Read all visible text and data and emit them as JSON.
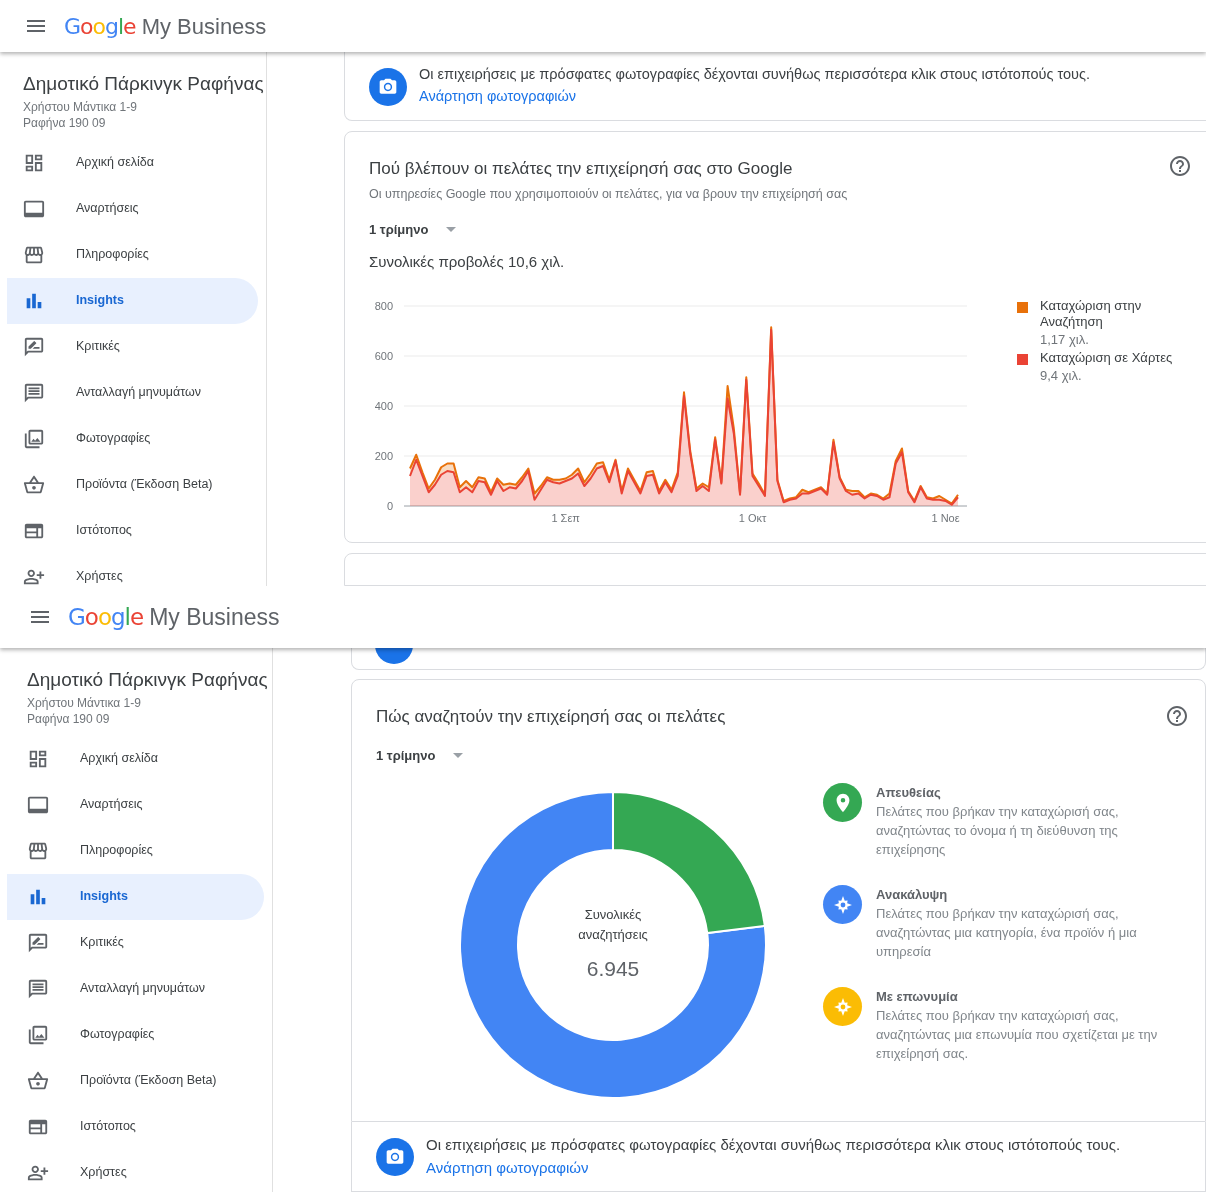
{
  "panels": [
    {
      "header": {
        "logo": "Google",
        "product": "My Business"
      },
      "sidebar": {
        "business_name": "Δημοτικό Πάρκινγκ Ραφήνας",
        "address_lines": [
          "Χρήστου Μάντικα 1-9",
          "Ραφήνα 190 09"
        ],
        "items": [
          {
            "label": "Αρχική σελίδα",
            "selected": false
          },
          {
            "label": "Αναρτήσεις",
            "selected": false
          },
          {
            "label": "Πληροφορίες",
            "selected": false
          },
          {
            "label": "Insights",
            "selected": true
          },
          {
            "label": "Κριτικές",
            "selected": false
          },
          {
            "label": "Ανταλλαγή μηνυμάτων",
            "selected": false
          },
          {
            "label": "Φωτογραφίες",
            "selected": false
          },
          {
            "label": "Προϊόντα (Έκδοση Beta)",
            "selected": false
          },
          {
            "label": "Ιστότοπος",
            "selected": false
          },
          {
            "label": "Χρήστες",
            "selected": false
          }
        ]
      },
      "cards": [
        {
          "kind": "photo_tip",
          "text": "Οι επιχειρήσεις με πρόσφατες φωτογραφίες δέχονται συνήθως περισσότερα κλικ στους ιστότοπούς τους.",
          "link": "Ανάρτηση φωτογραφιών"
        },
        {
          "kind": "views",
          "title": "Πού βλέπουν οι πελάτες την επιχείρησή σας στο Google",
          "subtitle": "Οι υπηρεσίες Google που χρησιμοποιούν οι πελάτες, για να βρουν την επιχείρησή σας",
          "period": "1 τρίμηνο",
          "total": "Συνολικές προβολές 10,6 χιλ.",
          "legend_totals": [
            "1,17 χιλ.",
            "9,4 χιλ."
          ],
          "chart_data": {
            "type": "area",
            "stacked": true,
            "categories": [
              null,
              null,
              null,
              null,
              null,
              null,
              null,
              null,
              null,
              null,
              null,
              null,
              null,
              null,
              null,
              null,
              null,
              null,
              null,
              null,
              null,
              null,
              null,
              null,
              null,
              "1 Σεπ",
              null,
              null,
              null,
              null,
              null,
              null,
              null,
              null,
              null,
              null,
              null,
              null,
              null,
              null,
              null,
              null,
              null,
              null,
              null,
              null,
              null,
              null,
              null,
              null,
              null,
              null,
              null,
              null,
              null,
              "1 Οκτ",
              null,
              null,
              null,
              null,
              null,
              null,
              null,
              null,
              null,
              null,
              null,
              null,
              null,
              null,
              null,
              null,
              null,
              null,
              null,
              null,
              null,
              null,
              null,
              null,
              null,
              null,
              null,
              null,
              null,
              null,
              "1 Νοε",
              null,
              null
            ],
            "ylim": [
              0,
              800
            ],
            "yticks": [
              0,
              200,
              400,
              600,
              800
            ],
            "grid": true,
            "series": [
              {
                "name": "Καταχώριση στην Αναζήτηση",
                "color": "#e8710a",
                "values": [
                  30,
                  20,
                  15,
                  15,
                  20,
                  30,
                  30,
                  35,
                  20,
                  25,
                  20,
                  15,
                  15,
                  10,
                  10,
                  25,
                  15,
                  15,
                  15,
                  10,
                  25,
                  15,
                  10,
                  10,
                  15,
                  10,
                  15,
                  20,
                  15,
                  20,
                  20,
                  15,
                  10,
                  5,
                  10,
                  10,
                  10,
                  10,
                  15,
                  15,
                  10,
                  10,
                  10,
                  15,
                  15,
                  10,
                  10,
                  10,
                  15,
                  10,
                  5,
                  50,
                  20,
                  5,
                  10,
                  10,
                  10,
                  5,
                  10,
                  5,
                  5,
                  5,
                  5,
                  15,
                  5,
                  5,
                  5,
                  5,
                  10,
                  5,
                  5,
                  15,
                  10,
                  5,
                  5,
                  5,
                  5,
                  15,
                  10,
                  15,
                  5,
                  5,
                  5,
                  5,
                  5,
                  15,
                  5,
                  5,
                  10
                ]
              },
              {
                "name": "Καταχώριση σε Χάρτες",
                "color": "#ea4335",
                "values": [
                  120,
                  185,
                  120,
                  55,
                  85,
                  125,
                  140,
                  135,
                  55,
                  75,
                  55,
                  100,
                  95,
                  45,
                  100,
                  60,
                  75,
                  70,
                  100,
                  140,
                  25,
                  65,
                  105,
                  95,
                  90,
                  100,
                  110,
                  130,
                  80,
                  110,
                  150,
                  160,
                  95,
                  180,
                  50,
                  140,
                  95,
                  50,
                  120,
                  125,
                  50,
                  95,
                  55,
                  120,
                  440,
                  210,
                  60,
                  80,
                  60,
                  265,
                  90,
                  430,
                  290,
                  45,
                  505,
                  120,
                  80,
                  40,
                  705,
                  100,
                  15,
                  25,
                  30,
                  50,
                  50,
                  60,
                  70,
                  45,
                  255,
                  110,
                  60,
                  45,
                  50,
                  30,
                  45,
                  40,
                  25,
                  35,
                  170,
                  215,
                  55,
                  15,
                  75,
                  30,
                  25,
                  25,
                  20,
                  5,
                  35
                ]
              }
            ]
          }
        },
        {
          "kind": "blank"
        }
      ]
    },
    {
      "header": {
        "logo": "Google",
        "product": "My Business"
      },
      "sidebar": {
        "business_name": "Δημοτικό Πάρκινγκ Ραφήνας",
        "address_lines": [
          "Χρήστου Μάντικα 1-9",
          "Ραφήνα 190 09"
        ],
        "items": [
          {
            "label": "Αρχική σελίδα",
            "selected": false
          },
          {
            "label": "Αναρτήσεις",
            "selected": false
          },
          {
            "label": "Πληροφορίες",
            "selected": false
          },
          {
            "label": "Insights",
            "selected": true
          },
          {
            "label": "Κριτικές",
            "selected": false
          },
          {
            "label": "Ανταλλαγή μηνυμάτων",
            "selected": false
          },
          {
            "label": "Φωτογραφίες",
            "selected": false
          },
          {
            "label": "Προϊόντα (Έκδοση Beta)",
            "selected": false
          },
          {
            "label": "Ιστότοπος",
            "selected": false
          },
          {
            "label": "Χρήστες",
            "selected": false
          }
        ]
      },
      "cards": [
        {
          "kind": "cut_banner"
        },
        {
          "kind": "searches",
          "title": "Πώς αναζητούν την επιχείρησή σας οι πελάτες",
          "period": "1 τρίμηνο",
          "center_label": "Συνολικές αναζητήσεις",
          "total": "6.945",
          "sources": [
            {
              "title": "Απευθείας",
              "description": "Πελάτες που βρήκαν την καταχώρισή σας, αναζητώντας το όνομα ή τη διεύθυνση της επιχείρησης",
              "color": "#34a853"
            },
            {
              "title": "Ανακάλυψη",
              "description": "Πελάτες που βρήκαν την καταχώρισή σας, αναζητώντας μια κατηγορία, ένα προϊόν ή μια υπηρεσία",
              "color": "#4285f4"
            },
            {
              "title": "Με επωνυμία",
              "description": "Πελάτες που βρήκαν την καταχώρισή σας, αναζητώντας μια επωνυμία που σχετίζεται με την επιχείρησή σας.",
              "color": "#fbbc04"
            }
          ]
        },
        {
          "kind": "photo_tip",
          "text": "Οι επιχειρήσεις με πρόσφατες φωτογραφίες δέχονται συνήθως περισσότερα κλικ στους ιστότοπούς τους.",
          "link": "Ανάρτηση φωτογραφιών"
        }
      ]
    }
  ]
}
